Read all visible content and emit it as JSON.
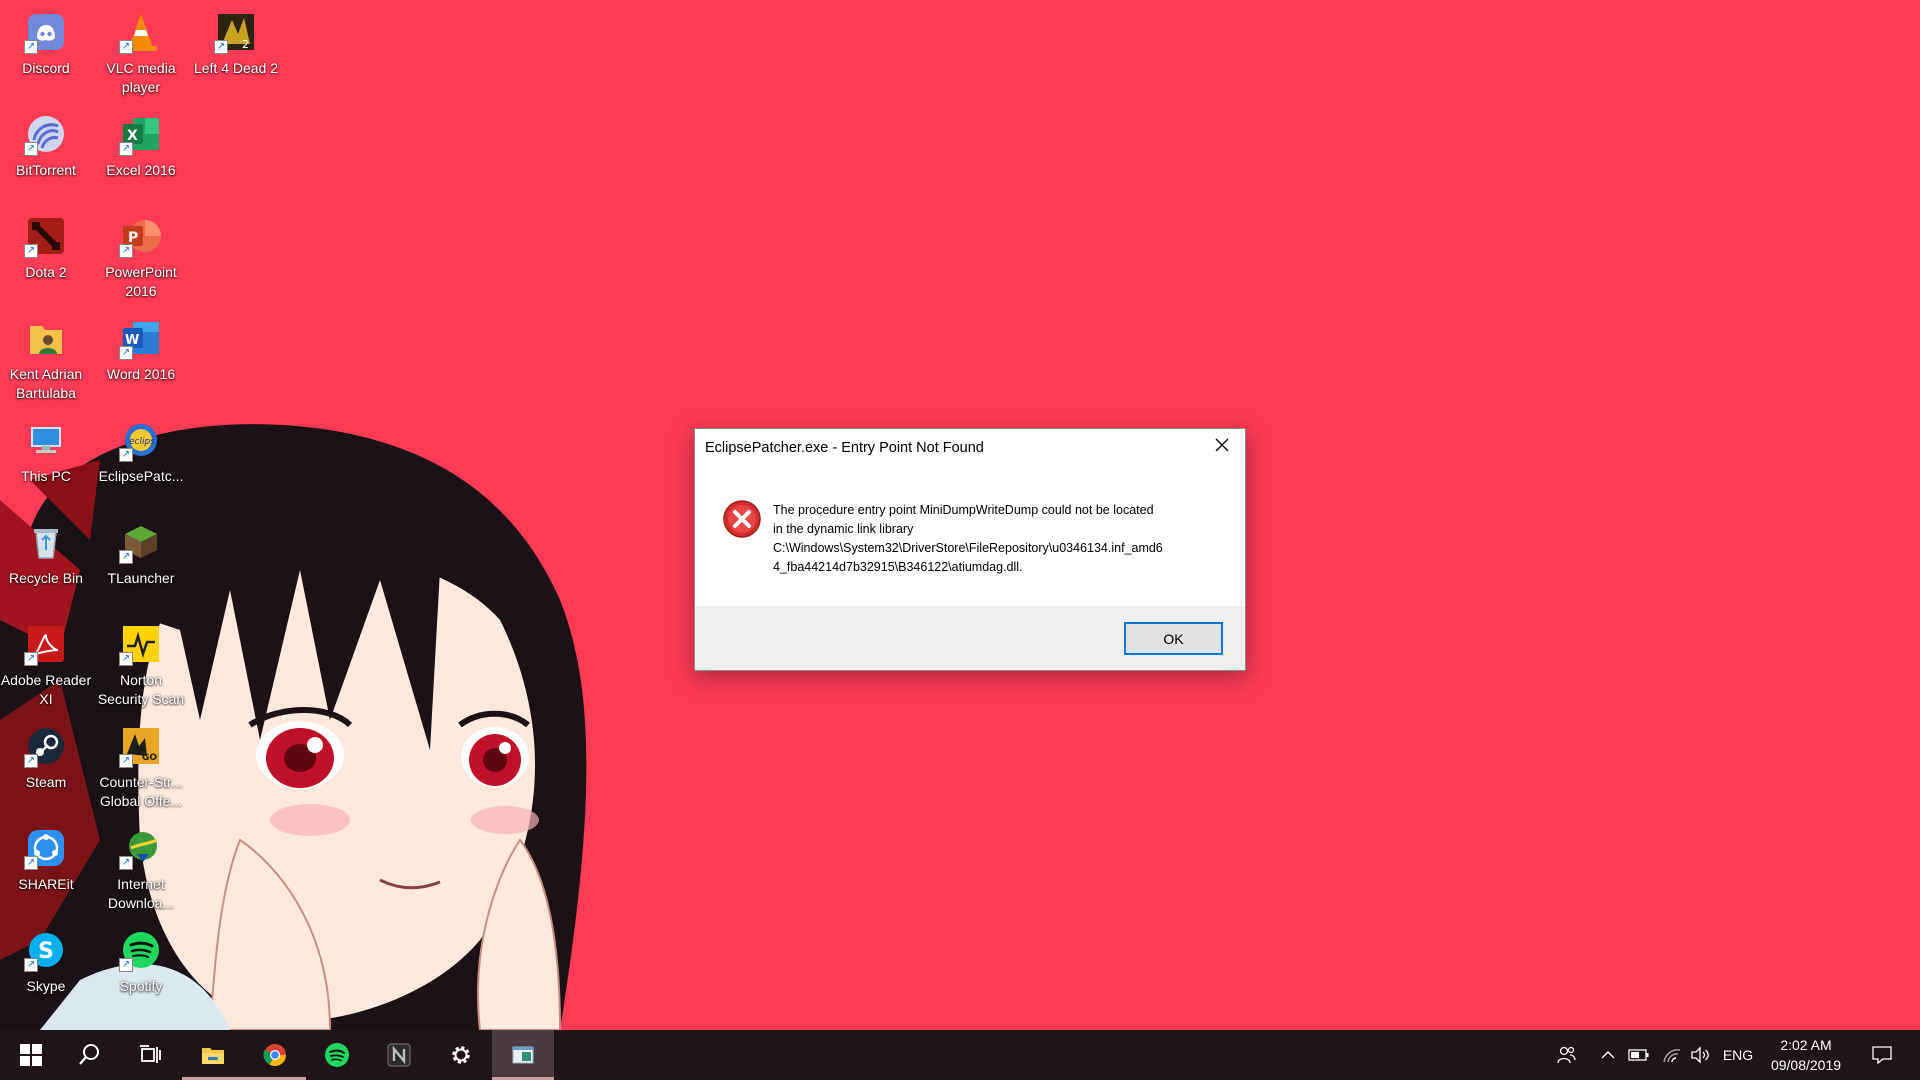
{
  "desktop": {
    "icons": [
      {
        "label": "Discord",
        "icon": "discord-icon"
      },
      {
        "label": "VLC media player",
        "icon": "vlc-icon"
      },
      {
        "label": "Left 4 Dead 2",
        "icon": "left4dead2-icon"
      },
      {
        "label": "BitTorrent",
        "icon": "bittorrent-icon"
      },
      {
        "label": "Excel 2016",
        "icon": "excel-icon"
      },
      {
        "label": "Dota 2",
        "icon": "dota2-icon"
      },
      {
        "label": "PowerPoint 2016",
        "icon": "powerpoint-icon"
      },
      {
        "label": "Kent Adrian Bartulaba",
        "icon": "user-folder-icon"
      },
      {
        "label": "Word 2016",
        "icon": "word-icon"
      },
      {
        "label": "This PC",
        "icon": "this-pc-icon"
      },
      {
        "label": "EclipsePatc...",
        "icon": "eclipse-patcher-icon"
      },
      {
        "label": "Recycle Bin",
        "icon": "recycle-bin-icon"
      },
      {
        "label": "TLauncher",
        "icon": "tlauncher-icon"
      },
      {
        "label": "Adobe Reader XI",
        "icon": "adobe-reader-icon"
      },
      {
        "label": "Norton Security Scan",
        "icon": "norton-icon"
      },
      {
        "label": "Steam",
        "icon": "steam-icon"
      },
      {
        "label": "Counter-Str... Global Offe...",
        "icon": "csgo-icon"
      },
      {
        "label": "SHAREit",
        "icon": "shareit-icon"
      },
      {
        "label": "Internet Downloa...",
        "icon": "internet-download-manager-icon"
      },
      {
        "label": "Skype",
        "icon": "skype-icon"
      },
      {
        "label": "Spotify",
        "icon": "spotify-icon"
      }
    ]
  },
  "dialog": {
    "title": "EclipsePatcher.exe - Entry Point Not Found",
    "message_lines": [
      "The procedure entry point MiniDumpWriteDump could not be located",
      "in the dynamic link library",
      "C:\\Windows\\System32\\DriverStore\\FileRepository\\u0346134.inf_amd6",
      "4_fba44214d7b32915\\B346122\\atiumdag.dll."
    ],
    "ok_label": "OK",
    "close_icon": "close-icon",
    "error_icon": "error-icon"
  },
  "taskbar": {
    "apps": [
      {
        "name": "start-button",
        "icon": "windows-logo-icon"
      },
      {
        "name": "search-button",
        "icon": "search-icon"
      },
      {
        "name": "task-view-button",
        "icon": "task-view-icon"
      },
      {
        "name": "file-explorer-button",
        "icon": "folder-icon"
      },
      {
        "name": "chrome-button",
        "icon": "chrome-icon"
      },
      {
        "name": "spotify-button",
        "icon": "spotify-icon"
      },
      {
        "name": "notion-button",
        "icon": "notion-icon"
      },
      {
        "name": "settings-button",
        "icon": "gear-icon"
      },
      {
        "name": "eclipse-patcher-button",
        "icon": "window-icon"
      }
    ],
    "tray": {
      "language": "ENG",
      "time": "2:02 AM",
      "date": "09/08/2019"
    }
  },
  "colors": {
    "wallpaper": "#fe3b55",
    "taskbar": "#1f1418",
    "accent": "#0078d7"
  }
}
